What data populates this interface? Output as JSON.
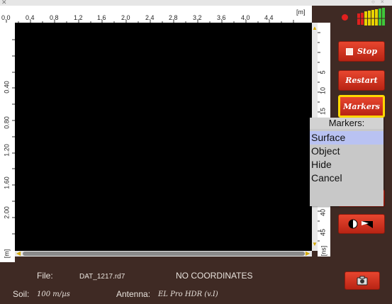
{
  "window": {
    "controls": "○ ×"
  },
  "axes": {
    "top_ticks": [
      "0.0",
      "0.4",
      "0.8",
      "1.2",
      "1.6",
      "2.0",
      "2.4",
      "2.8",
      "3.2",
      "3.6",
      "4.0",
      "4.4"
    ],
    "top_unit": "[m]",
    "left_ticks": [
      "0.40",
      "0.80",
      "1.20",
      "1.60",
      "2.00"
    ],
    "left_unit": "[m]",
    "right_ticks": [
      "5",
      "10",
      "15",
      "20",
      "25",
      "30",
      "35",
      "40",
      "45"
    ],
    "right_unit": "[ns]"
  },
  "toolbar": {
    "stop_label": "Stop",
    "restart_label": "Restart",
    "markers_label": "Markers"
  },
  "markers_menu": {
    "title": "Markers:",
    "items": [
      "Surface",
      "Object",
      "Hide",
      "Cancel"
    ],
    "selected": "Surface"
  },
  "info": {
    "file_label": "File:",
    "file_name": "DAT_1217.rd7",
    "coordinates": "NO COORDINATES",
    "soil_label": "Soil:",
    "soil_value": "100 m/µs",
    "antenna_label": "Antenna:",
    "antenna_value": "EL Pro HDR (v.I)"
  },
  "colors": {
    "background": "#3f2a24",
    "button_red": "#d2301c",
    "highlight_yellow": "#ffd800",
    "status_dot": "#e0201e"
  },
  "icons": {
    "stop": "square-icon",
    "contrast": "contrast-icon",
    "camera": "camera-icon",
    "signal": "signal-level-icon"
  }
}
